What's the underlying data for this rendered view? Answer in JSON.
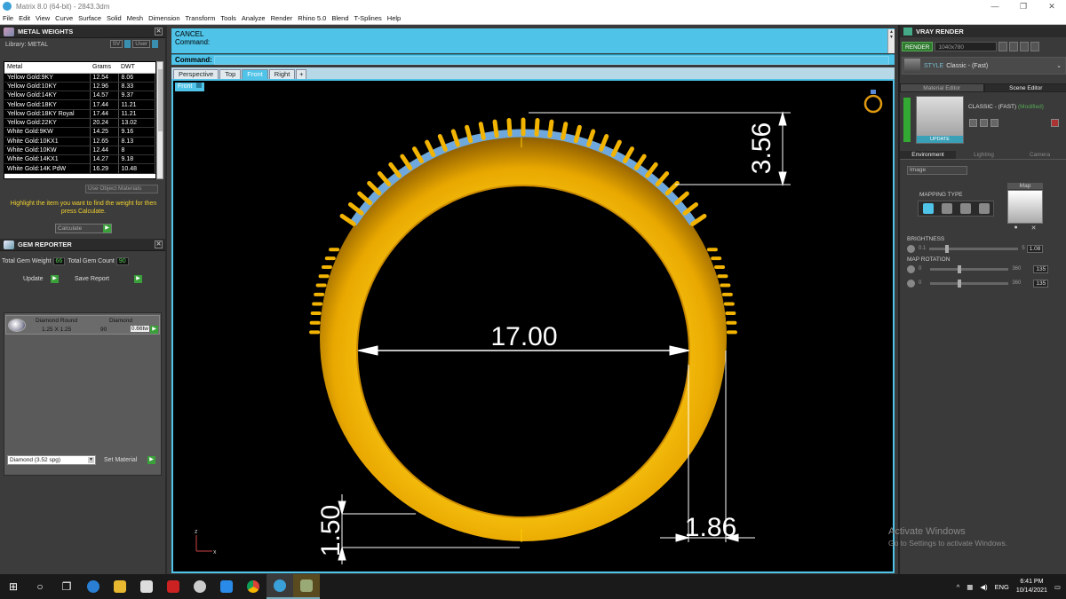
{
  "window": {
    "title": "Matrix 8.0 (64-bit) - 2843.3dm",
    "controls": [
      "—",
      "❐",
      "✕"
    ]
  },
  "menu": [
    "File",
    "Edit",
    "View",
    "Curve",
    "Surface",
    "Solid",
    "Mesh",
    "Dimension",
    "Transform",
    "Tools",
    "Analyze",
    "Render",
    "Rhino 5.0",
    "Blend",
    "T-Splines",
    "Help"
  ],
  "metal_weights": {
    "title": "METAL WEIGHTS",
    "library": "Library: METAL",
    "toggle_sv": "SV",
    "toggle_user": "User",
    "columns": [
      "Metal",
      "Grams",
      "DWT"
    ],
    "rows": [
      [
        "Yellow Gold:9KY",
        "12.54",
        "8.06"
      ],
      [
        "Yellow Gold:10KY",
        "12.96",
        "8.33"
      ],
      [
        "Yellow Gold:14KY",
        "14.57",
        "9.37"
      ],
      [
        "Yellow Gold:18KY",
        "17.44",
        "11.21"
      ],
      [
        "Yellow Gold:18KY Royal",
        "17.44",
        "11.21"
      ],
      [
        "Yellow Gold:22KY",
        "20.24",
        "13.02"
      ],
      [
        "White Gold:9KW",
        "14.25",
        "9.16"
      ],
      [
        "White Gold:10KX1",
        "12.65",
        "8.13"
      ],
      [
        "White Gold:10KW",
        "12.44",
        "8"
      ],
      [
        "White Gold:14KX1",
        "14.27",
        "9.18"
      ],
      [
        "White Gold:14K PdW",
        "16.29",
        "10.48"
      ]
    ],
    "use_object_materials": "Use Object Materials",
    "hint": "Highlight the item you want to find the weight for then press Calculate.",
    "calculate": "Calculate"
  },
  "gem_reporter": {
    "title": "GEM REPORTER",
    "total_weight_label": "Total Gem Weight",
    "total_weight": "66",
    "total_count_label": "Total Gem Count",
    "total_count": "90",
    "update": "Update",
    "save_report": "Save Report",
    "gem": {
      "shape": "Diamond Round",
      "material": "Diamond",
      "size": "1.25 X 1.25",
      "count": "90",
      "weight": "0.66tw"
    },
    "material_select": "Diamond    (3.52 spg)",
    "set_material": "Set Material"
  },
  "command": {
    "history_1": "CANCEL",
    "history_2": "Command:",
    "prompt": "Command:"
  },
  "viewport": {
    "tabs": [
      "Perspective",
      "Top",
      "Front",
      "Right"
    ],
    "active_tab": "Front",
    "label": "Front",
    "dimensions": {
      "top_width": "3.56",
      "inner_diameter": "17.00",
      "bottom_thickness": "1.50",
      "side_thickness": "1.86"
    },
    "axis_z": "z",
    "axis_x": "x"
  },
  "vray": {
    "title": "VRAY RENDER",
    "render": "RENDER",
    "resolution": "1040x780",
    "style_label": "STYLE",
    "style_value": "Classic - (Fast)",
    "tab_material_editor": "Material Editor",
    "tab_scene_editor": "Scene Editor",
    "material_name": "CLASSIC - (FAST)",
    "material_status": "(Modified)",
    "update": "UPDATE",
    "env_tabs": [
      "Environment",
      "Lighting",
      "Camera"
    ],
    "env_type": "Image",
    "mapping_type": "MAPPING TYPE",
    "map": "Map",
    "brightness": {
      "label": "BRIGHTNESS",
      "min": "0.1",
      "max": "5",
      "value": "1.08",
      "fraction": 0.2
    },
    "map_rotation": {
      "label": "MAP ROTATION",
      "min": "0",
      "max": "360",
      "value": "135",
      "fraction": 0.375
    },
    "map_rotation_2": {
      "min": "0",
      "max": "360",
      "value": "135",
      "fraction": 0.375
    }
  },
  "activation": {
    "title": "Activate Windows",
    "subtitle": "Go to Settings to activate Windows."
  },
  "taskbar": {
    "lang": "ENG",
    "time": "6:41 PM",
    "date": "10/14/2021"
  },
  "colors": {
    "accent": "#4fc3e8",
    "gold": "#f2b400",
    "gem_blue": "#6fa8dc"
  }
}
